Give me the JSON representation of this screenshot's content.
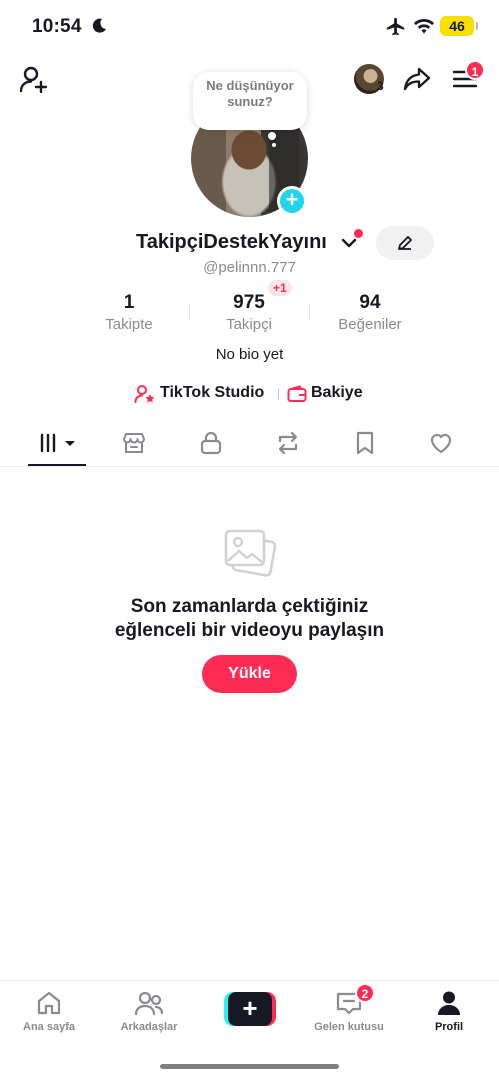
{
  "status_bar": {
    "time": "10:54",
    "battery": "46"
  },
  "top_nav": {
    "story_count": "3",
    "menu_badge": "1"
  },
  "profile": {
    "thought_bubble": "Ne düşünüyorsunuz?",
    "display_name": "TakipçiDestekYayını",
    "handle": "@pelinnn.777",
    "bio": "No bio yet"
  },
  "stats": {
    "following": {
      "value": "1",
      "label": "Takipte"
    },
    "followers": {
      "value": "975",
      "label": "Takipçi",
      "delta": "+1"
    },
    "likes": {
      "value": "94",
      "label": "Beğeniler"
    }
  },
  "links": {
    "studio": "TikTok Studio",
    "balance": "Bakiye"
  },
  "tabs": [
    "videos-grid-icon",
    "shop-icon",
    "lock-icon",
    "repost-icon",
    "bookmark-icon",
    "heart-icon"
  ],
  "empty_state": {
    "title_line1": "Son zamanlarda çektiğiniz",
    "title_line2": "eğlenceli bir videoyu paylaşın",
    "button": "Yükle"
  },
  "bottom_nav": {
    "home": "Ana sayfa",
    "friends": "Arkadaşlar",
    "create": "+",
    "inbox": "Gelen kutusu",
    "inbox_badge": "2",
    "profile": "Profil"
  },
  "colors": {
    "accent": "#fe2c55",
    "cyan": "#20d5ec",
    "battery": "#f7e000"
  }
}
